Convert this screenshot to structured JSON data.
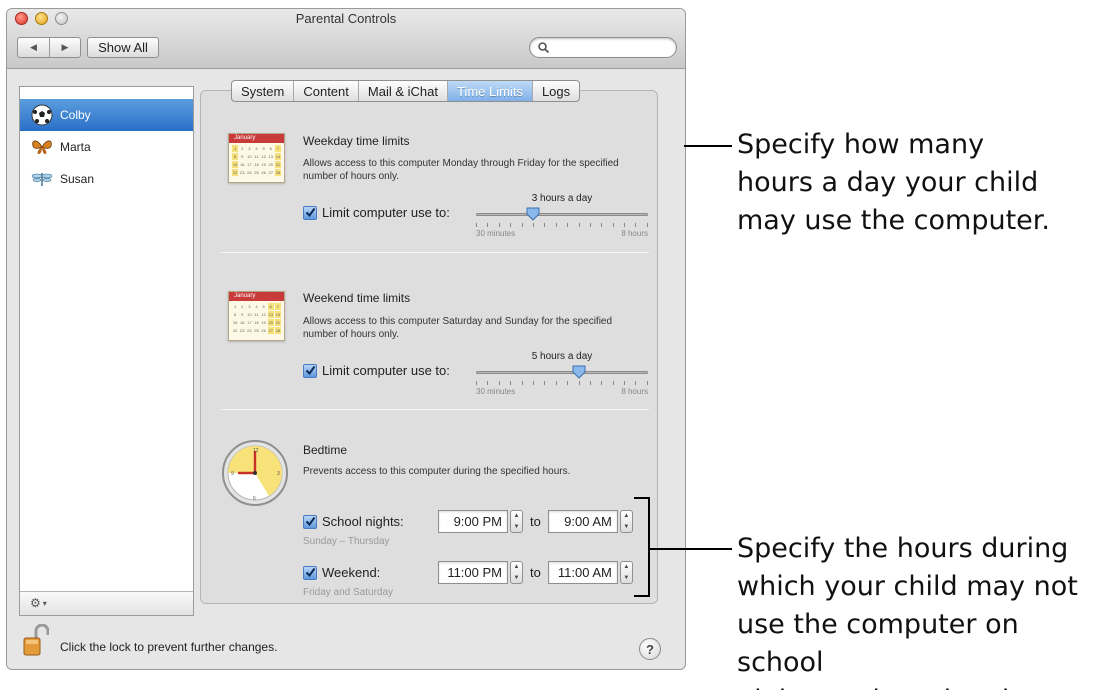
{
  "window": {
    "title": "Parental Controls",
    "show_all": "Show All",
    "search_placeholder": ""
  },
  "users": [
    {
      "name": "Colby",
      "icon": "soccer-ball-icon",
      "selected": true
    },
    {
      "name": "Marta",
      "icon": "butterfly-icon",
      "selected": false
    },
    {
      "name": "Susan",
      "icon": "dragonfly-icon",
      "selected": false
    }
  ],
  "tabs": [
    {
      "label": "System",
      "active": false
    },
    {
      "label": "Content",
      "active": false
    },
    {
      "label": "Mail & iChat",
      "active": false
    },
    {
      "label": "Time Limits",
      "active": true
    },
    {
      "label": "Logs",
      "active": false
    }
  ],
  "weekday": {
    "calendar_month": "January",
    "title": "Weekday time limits",
    "description": "Allows access to this computer Monday through Friday for the specified number of hours only.",
    "checkbox_label": "Limit computer use to:",
    "checked": true,
    "slider_value": "3 hours a day",
    "slider_fraction": 0.33,
    "slider_min": "30 minutes",
    "slider_max": "8 hours"
  },
  "weekend": {
    "calendar_month": "January",
    "title": "Weekend time limits",
    "description": "Allows access to this computer Saturday and Sunday for the specified number of hours only.",
    "checkbox_label": "Limit computer use to:",
    "checked": true,
    "slider_value": "5 hours a day",
    "slider_fraction": 0.6,
    "slider_min": "30 minutes",
    "slider_max": "8 hours"
  },
  "bedtime": {
    "title": "Bedtime",
    "description": "Prevents access to this computer during the specified hours.",
    "school": {
      "label": "School nights:",
      "checked": true,
      "sub": "Sunday – Thursday",
      "from": "9:00 PM",
      "to_label": "to",
      "to": "9:00 AM"
    },
    "weekend": {
      "label": "Weekend:",
      "checked": true,
      "sub": "Friday and Saturday",
      "from": "11:00 PM",
      "to_label": "to",
      "to": "11:00 AM"
    }
  },
  "footer": {
    "lock_text": "Click the lock to prevent further changes.",
    "help": "?"
  },
  "callouts": {
    "top": [
      "Specify how many",
      "hours a day your child",
      "may use the computer."
    ],
    "bottom": [
      "Specify the hours during",
      "which your child may not",
      "use the computer on school",
      "nights and weekends."
    ]
  },
  "colors": {
    "selection": "#2a6fc8",
    "tab_active": "#7fb1e8",
    "calendar_header": "#c93a3a",
    "clock_face": "#f8e27a"
  }
}
